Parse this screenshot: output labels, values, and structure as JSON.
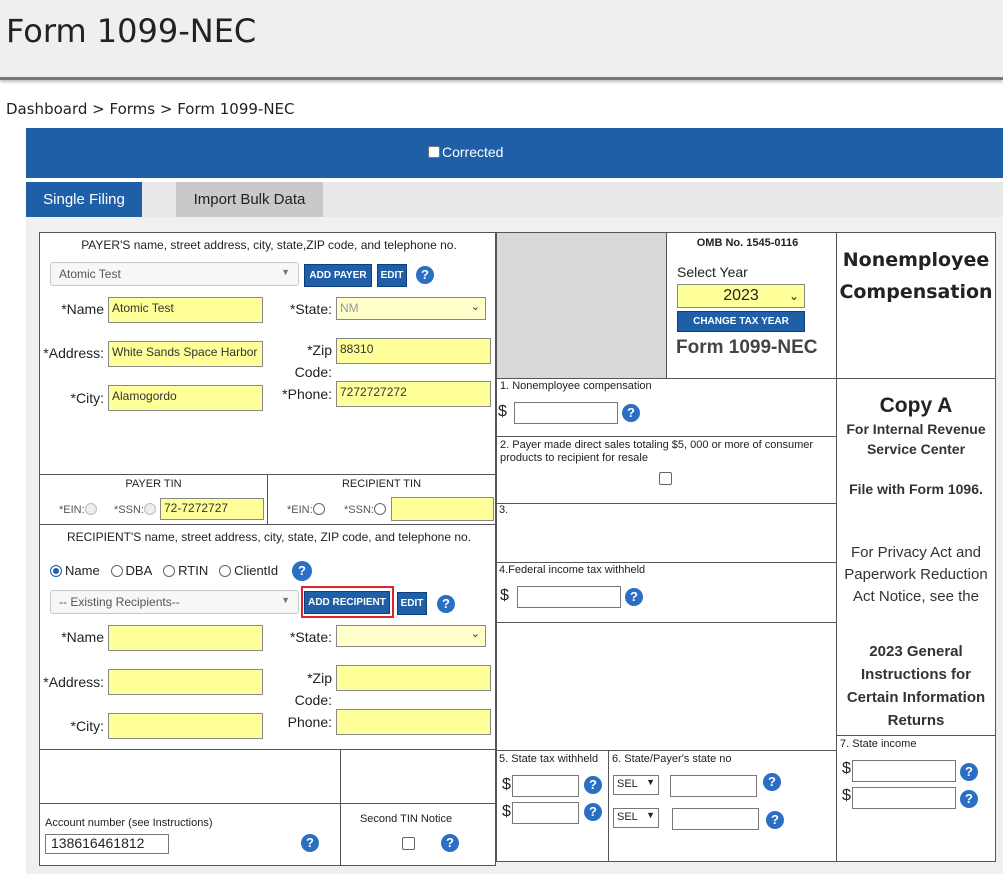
{
  "page": {
    "title": "Form 1099-NEC",
    "breadcrumb": "Dashboard > Forms > Form 1099-NEC"
  },
  "bar": {
    "corrected_label": "Corrected"
  },
  "tabs": [
    "Single Filing",
    "Import Bulk Data"
  ],
  "payer": {
    "heading": "PAYER'S name, street address, city, state,ZIP code, and telephone no.",
    "select_value": "Atomic Test",
    "add_button": "ADD PAYER",
    "edit_button": "EDIT",
    "name_label": "*Name",
    "name_value": "Atomic Test",
    "address_label": "*Address:",
    "address_value": "White Sands Space Harbor",
    "city_label": "*City:",
    "city_value": "Alamogordo",
    "state_label": "*State:",
    "state_value": "NM",
    "zip_label": "*Zip",
    "zip_label2": "Code:",
    "zip_value": "88310",
    "phone_label": "*Phone:",
    "phone_value": "7272727272"
  },
  "tin": {
    "payer_tin_label": "PAYER TIN",
    "recipient_tin_label": "RECIPIENT TIN",
    "ein_label": "*EIN:",
    "ssn_label": "*SSN:",
    "payer_tin_value": "72-7272727",
    "recipient_tin_value": ""
  },
  "recipient": {
    "heading": "RECIPIENT'S name, street address, city, state, ZIP code, and telephone no.",
    "options": [
      "Name",
      "DBA",
      "RTIN",
      "ClientId"
    ],
    "select_value": "-- Existing Recipients--",
    "add_button": "ADD RECIPIENT",
    "edit_button": "EDIT",
    "name_label": "*Name",
    "address_label": "*Address:",
    "city_label": "*City:",
    "state_label": "*State:",
    "zip_label": "*Zip",
    "zip_label2": "Code:",
    "phone_label": "Phone:"
  },
  "account": {
    "label": "Account number (see Instructions)",
    "value": "138616461812",
    "second_tin_label": "Second TIN Notice"
  },
  "omb": {
    "number": "OMB No. 1545-0116",
    "select_year_label": "Select Year",
    "year": "2023",
    "change_button": "CHANGE TAX YEAR",
    "form_name": "Form 1099-NEC"
  },
  "title_box": {
    "line1": "Nonemployee",
    "line2": "Compensation"
  },
  "boxes": {
    "b1": "1. Nonemployee compensation",
    "b2": "2. Payer made direct sales totaling $5, 000 or more of consumer products to recipient for resale",
    "b3": "3.",
    "b4": "4.Federal income tax withheld",
    "b5": "5. State tax withheld",
    "b6": "6. State/Payer's state no",
    "b7": "7. State income",
    "dollar": "$",
    "sel": "SEL"
  },
  "copy": {
    "title": "Copy A",
    "sub1": "For Internal Revenue",
    "sub2": "Service Center",
    "file_with": "File with Form 1096.",
    "privacy1": "For Privacy Act and",
    "privacy2": "Paperwork Reduction",
    "privacy3": "Act Notice, see the",
    "gen1": "2023 General",
    "gen2": "Instructions for",
    "gen3": "Certain Information",
    "gen4": "Returns"
  },
  "help_glyph": "?",
  "colors": {
    "primary": "#1e5fa8",
    "field": "#ffff99",
    "highlight": "#d9262c"
  }
}
